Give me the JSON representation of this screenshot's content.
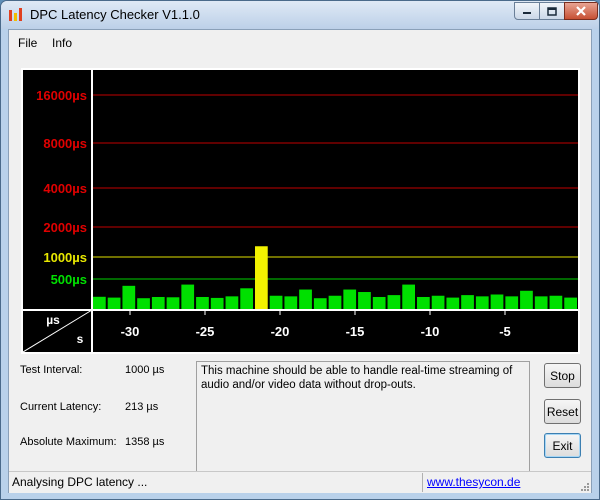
{
  "window": {
    "title": "DPC Latency Checker V1.1.0"
  },
  "menu": {
    "file": "File",
    "info": "Info"
  },
  "chart_data": {
    "type": "bar",
    "title": "",
    "y_labels": [
      {
        "text": "16000µs",
        "color": "#e00000"
      },
      {
        "text": "8000µs",
        "color": "#e00000"
      },
      {
        "text": "4000µs",
        "color": "#e00000"
      },
      {
        "text": "2000µs",
        "color": "#e00000"
      },
      {
        "text": "1000µs",
        "color": "#e8e800"
      },
      {
        "text": "500µs",
        "color": "#00e000"
      }
    ],
    "corner_labels": {
      "y_unit": "µs",
      "x_unit": "s"
    },
    "x_ticks": [
      "-30",
      "-25",
      "-20",
      "-15",
      "-10",
      "-5"
    ],
    "values": [
      213,
      200,
      390,
      190,
      210,
      205,
      410,
      210,
      195,
      220,
      350,
      1358,
      230,
      220,
      330,
      190,
      230,
      330,
      290,
      210,
      240,
      410,
      210,
      230,
      200,
      240,
      220,
      250,
      220,
      310,
      220,
      230,
      200
    ],
    "bar_colors": {
      "normal": "#00e000",
      "warning": "#f2f200"
    },
    "thresholds_us": {
      "ok": 500,
      "warn": 1000
    },
    "grid_lines": [
      {
        "value": 16000,
        "color": "#c00000"
      },
      {
        "value": 8000,
        "color": "#c00000"
      },
      {
        "value": 4000,
        "color": "#c00000"
      },
      {
        "value": 2000,
        "color": "#c00000"
      },
      {
        "value": 1000,
        "color": "#e0e000"
      },
      {
        "value": 500,
        "color": "#00d000"
      }
    ]
  },
  "info": {
    "test_interval_label": "Test Interval:",
    "test_interval_value": "1000 µs",
    "current_latency_label": "Current Latency:",
    "current_latency_value": "213 µs",
    "absolute_max_label": "Absolute Maximum:",
    "absolute_max_value": "1358 µs"
  },
  "message": "This machine should be able to handle real-time streaming of audio and/or video data without drop-outs.",
  "buttons": {
    "stop": "Stop",
    "reset": "Reset",
    "exit": "Exit"
  },
  "status": {
    "text": "Analysing DPC latency ...",
    "link": "www.thesycon.de"
  }
}
